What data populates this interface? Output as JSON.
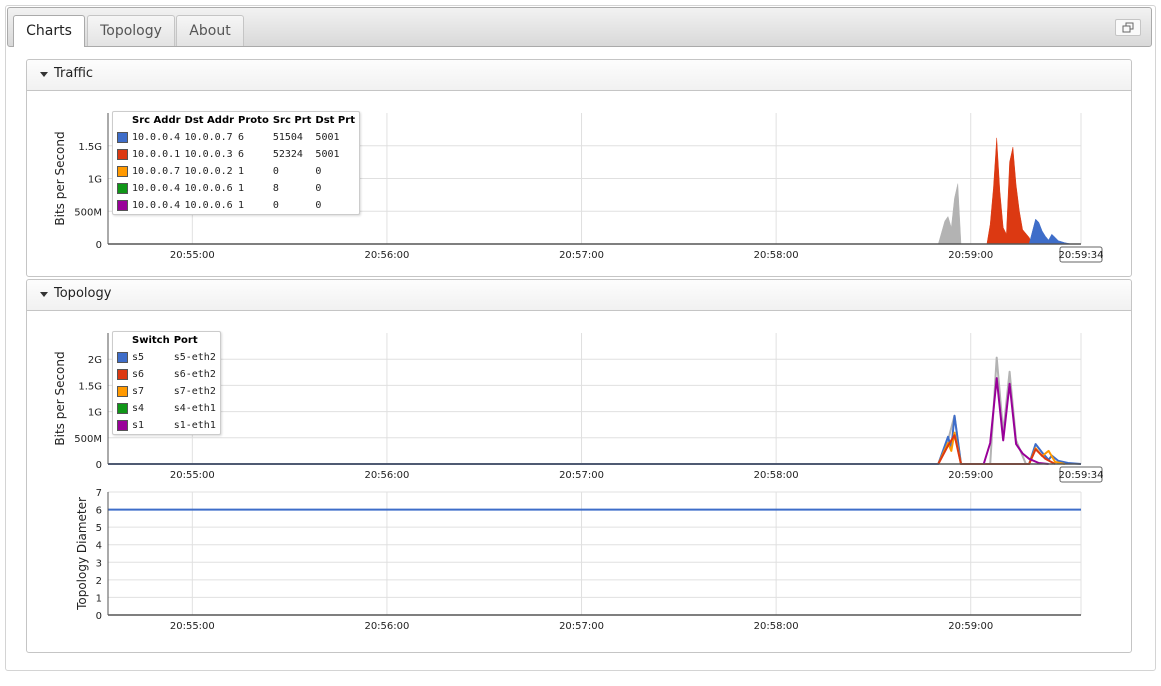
{
  "tabs": [
    {
      "label": "Charts",
      "active": true
    },
    {
      "label": "Topology",
      "active": false
    },
    {
      "label": "About",
      "active": false
    }
  ],
  "colors": {
    "blue": "#3e6dc9",
    "red": "#dc3912",
    "orange": "#ff9900",
    "green": "#109618",
    "purple": "#990099",
    "gray": "#b3b3b3"
  },
  "traffic": {
    "title": "Traffic",
    "legend_headers": [
      "Src Addr",
      "Dst Addr",
      "Proto",
      "Src Prt",
      "Dst Prt"
    ],
    "legend_rows": [
      {
        "color": "#3e6dc9",
        "cells": [
          "10.0.0.4",
          "10.0.0.7",
          "6",
          "51504",
          "5001"
        ]
      },
      {
        "color": "#dc3912",
        "cells": [
          "10.0.0.1",
          "10.0.0.3",
          "6",
          "52324",
          "5001"
        ]
      },
      {
        "color": "#ff9900",
        "cells": [
          "10.0.0.7",
          "10.0.0.2",
          "1",
          "0",
          "0"
        ]
      },
      {
        "color": "#109618",
        "cells": [
          "10.0.0.4",
          "10.0.0.6",
          "1",
          "8",
          "0"
        ]
      },
      {
        "color": "#990099",
        "cells": [
          "10.0.0.4",
          "10.0.0.6",
          "1",
          "0",
          "0"
        ]
      }
    ]
  },
  "topology": {
    "title": "Topology",
    "legend_headers": [
      "Switch",
      "Port"
    ],
    "legend_rows": [
      {
        "color": "#3e6dc9",
        "cells": [
          "s5",
          "s5-eth2"
        ]
      },
      {
        "color": "#dc3912",
        "cells": [
          "s6",
          "s6-eth2"
        ]
      },
      {
        "color": "#ff9900",
        "cells": [
          "s7",
          "s7-eth2"
        ]
      },
      {
        "color": "#109618",
        "cells": [
          "s4",
          "s4-eth1"
        ]
      },
      {
        "color": "#990099",
        "cells": [
          "s1",
          "s1-eth1"
        ]
      }
    ]
  },
  "chart_data": [
    {
      "id": "traffic",
      "type": "area",
      "ylabel": "Bits per Second",
      "x_range": [
        "20:54:34",
        "20:59:34"
      ],
      "x_ticks": [
        "20:55:00",
        "20:56:00",
        "20:57:00",
        "20:58:00",
        "20:59:00"
      ],
      "x_end_label": "20:59:34",
      "y_ticks": [
        {
          "value": 0,
          "label": "0"
        },
        {
          "value": 500000000,
          "label": "500M"
        },
        {
          "value": 1000000000,
          "label": "1G"
        },
        {
          "value": 1500000000,
          "label": "1.5G"
        }
      ],
      "ylim": [
        0,
        2000000000
      ],
      "grid": true,
      "series": [
        {
          "color": "#b3b3b3",
          "points": [
            [
              "20:58:50",
              0
            ],
            [
              "20:58:52",
              350000000
            ],
            [
              "20:58:53",
              420000000
            ],
            [
              "20:58:54",
              250000000
            ],
            [
              "20:58:55",
              700000000
            ],
            [
              "20:58:56",
              920000000
            ],
            [
              "20:58:57",
              0
            ]
          ]
        },
        {
          "color": "#dc3912",
          "points": [
            [
              "20:59:05",
              0
            ],
            [
              "20:59:06",
              300000000
            ],
            [
              "20:59:07",
              850000000
            ],
            [
              "20:59:08",
              1620000000
            ],
            [
              "20:59:09",
              800000000
            ],
            [
              "20:59:10",
              250000000
            ],
            [
              "20:59:11",
              150000000
            ],
            [
              "20:59:12",
              1250000000
            ],
            [
              "20:59:13",
              1480000000
            ],
            [
              "20:59:14",
              900000000
            ],
            [
              "20:59:15",
              500000000
            ],
            [
              "20:59:16",
              220000000
            ],
            [
              "20:59:18",
              100000000
            ],
            [
              "20:59:19",
              0
            ]
          ]
        },
        {
          "color": "#3e6dc9",
          "points": [
            [
              "20:59:18",
              0
            ],
            [
              "20:59:20",
              380000000
            ],
            [
              "20:59:21",
              330000000
            ],
            [
              "20:59:22",
              200000000
            ],
            [
              "20:59:23",
              120000000
            ],
            [
              "20:59:24",
              60000000
            ],
            [
              "20:59:25",
              150000000
            ],
            [
              "20:59:26",
              100000000
            ],
            [
              "20:59:27",
              50000000
            ],
            [
              "20:59:29",
              20000000
            ],
            [
              "20:59:31",
              0
            ]
          ]
        }
      ]
    },
    {
      "id": "topology-bps",
      "type": "line",
      "ylabel": "Bits per Second",
      "x_range": [
        "20:54:34",
        "20:59:34"
      ],
      "x_ticks": [
        "20:55:00",
        "20:56:00",
        "20:57:00",
        "20:58:00",
        "20:59:00"
      ],
      "x_end_label": "20:59:34",
      "y_ticks": [
        {
          "value": 0,
          "label": "0"
        },
        {
          "value": 500000000,
          "label": "500M"
        },
        {
          "value": 1000000000,
          "label": "1G"
        },
        {
          "value": 1500000000,
          "label": "1.5G"
        },
        {
          "value": 2000000000,
          "label": "2G"
        }
      ],
      "ylim": [
        0,
        2500000000
      ],
      "grid": true,
      "series": [
        {
          "color": "#b3b3b3",
          "points": [
            [
              "20:58:50",
              0
            ],
            [
              "20:58:53",
              450000000
            ],
            [
              "20:58:55",
              920000000
            ],
            [
              "20:58:57",
              0
            ],
            [
              "20:59:06",
              0
            ],
            [
              "20:59:08",
              2030000000
            ],
            [
              "20:59:10",
              600000000
            ],
            [
              "20:59:12",
              1760000000
            ],
            [
              "20:59:14",
              450000000
            ],
            [
              "20:59:17",
              0
            ]
          ]
        },
        {
          "color": "#3e6dc9",
          "points": [
            [
              "20:54:34",
              0
            ],
            [
              "20:58:50",
              0
            ],
            [
              "20:58:53",
              520000000
            ],
            [
              "20:58:54",
              300000000
            ],
            [
              "20:58:55",
              920000000
            ],
            [
              "20:58:57",
              0
            ],
            [
              "20:59:18",
              0
            ],
            [
              "20:59:20",
              380000000
            ],
            [
              "20:59:22",
              220000000
            ],
            [
              "20:59:24",
              80000000
            ],
            [
              "20:59:25",
              160000000
            ],
            [
              "20:59:27",
              60000000
            ],
            [
              "20:59:30",
              20000000
            ],
            [
              "20:59:34",
              0
            ]
          ]
        },
        {
          "color": "#ff9900",
          "points": [
            [
              "20:58:50",
              0
            ],
            [
              "20:58:53",
              400000000
            ],
            [
              "20:58:54",
              250000000
            ],
            [
              "20:58:55",
              600000000
            ],
            [
              "20:58:57",
              0
            ],
            [
              "20:59:18",
              0
            ],
            [
              "20:59:20",
              300000000
            ],
            [
              "20:59:22",
              150000000
            ],
            [
              "20:59:24",
              250000000
            ],
            [
              "20:59:26",
              40000000
            ],
            [
              "20:59:29",
              0
            ]
          ]
        },
        {
          "color": "#dc3912",
          "points": [
            [
              "20:58:50",
              0
            ],
            [
              "20:58:53",
              350000000
            ],
            [
              "20:58:55",
              550000000
            ],
            [
              "20:58:57",
              0
            ],
            [
              "20:59:18",
              0
            ],
            [
              "20:59:20",
              280000000
            ],
            [
              "20:59:23",
              100000000
            ],
            [
              "20:59:26",
              0
            ]
          ]
        },
        {
          "color": "#990099",
          "points": [
            [
              "20:59:04",
              0
            ],
            [
              "20:59:06",
              400000000
            ],
            [
              "20:59:08",
              1640000000
            ],
            [
              "20:59:10",
              450000000
            ],
            [
              "20:59:12",
              1530000000
            ],
            [
              "20:59:14",
              380000000
            ],
            [
              "20:59:16",
              200000000
            ],
            [
              "20:59:18",
              100000000
            ],
            [
              "20:59:21",
              20000000
            ],
            [
              "20:59:24",
              0
            ]
          ]
        }
      ]
    },
    {
      "id": "topology-diameter",
      "type": "line",
      "ylabel": "Topology Diameter",
      "x_range": [
        "20:54:34",
        "20:59:34"
      ],
      "x_ticks": [
        "20:55:00",
        "20:56:00",
        "20:57:00",
        "20:58:00",
        "20:59:00"
      ],
      "x_end_label": "",
      "y_ticks": [
        {
          "value": 0,
          "label": "0"
        },
        {
          "value": 1,
          "label": "1"
        },
        {
          "value": 2,
          "label": "2"
        },
        {
          "value": 3,
          "label": "3"
        },
        {
          "value": 4,
          "label": "4"
        },
        {
          "value": 5,
          "label": "5"
        },
        {
          "value": 6,
          "label": "6"
        },
        {
          "value": 7,
          "label": "7"
        }
      ],
      "ylim": [
        0,
        7
      ],
      "grid": true,
      "series": [
        {
          "color": "#3e6dc9",
          "points": [
            [
              "20:54:34",
              6
            ],
            [
              "20:59:34",
              6
            ]
          ]
        }
      ]
    }
  ]
}
